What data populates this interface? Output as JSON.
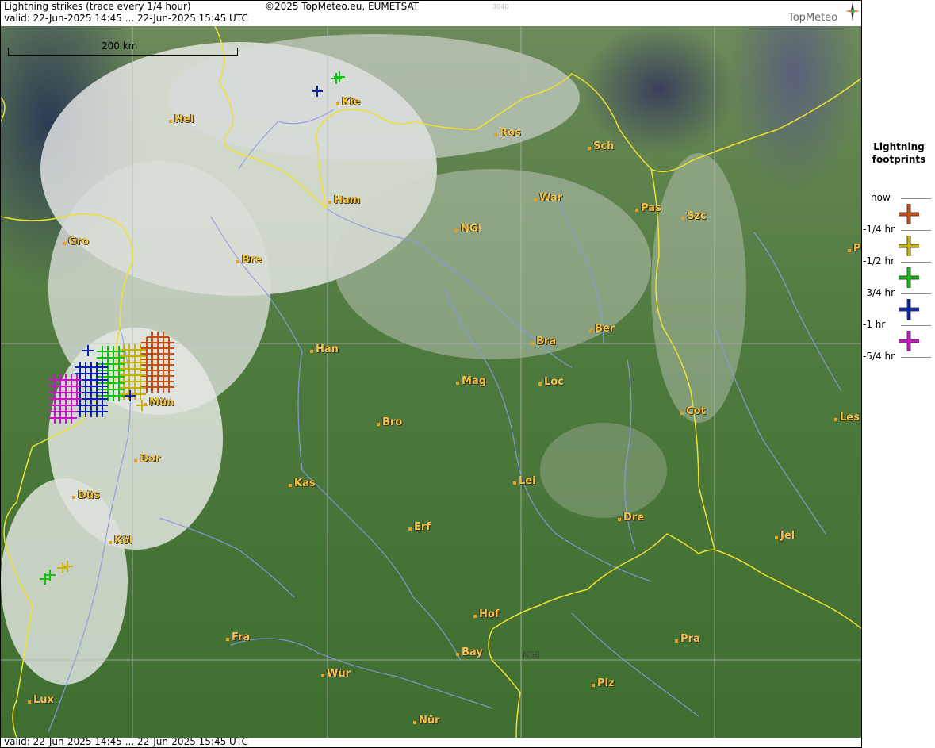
{
  "header": {
    "title": "Lightning strikes (trace every 1/4 hour)",
    "copyright": "©2025 TopMeteo.eu, EUMETSAT",
    "code": "3040",
    "valid": "valid:  22-Jun-2025 14:45 ... 22-Jun-2025 15:45 UTC",
    "logo": "TopMeteo"
  },
  "footer": {
    "valid": "valid:  22-Jun-2025 14:45 ... 22-Jun-2025 15:45 UTC"
  },
  "map": {
    "scale_label": "200 km",
    "gridline_label": "N50",
    "cities": [
      {
        "name": "Kie"
      },
      {
        "name": "Hel"
      },
      {
        "name": "Ros"
      },
      {
        "name": "Sch"
      },
      {
        "name": "Ham"
      },
      {
        "name": "War"
      },
      {
        "name": "NGl"
      },
      {
        "name": "Pas"
      },
      {
        "name": "Szc"
      },
      {
        "name": "Gro"
      },
      {
        "name": "Bre"
      },
      {
        "name": "Pi"
      },
      {
        "name": "Ber"
      },
      {
        "name": "Bra"
      },
      {
        "name": "Han"
      },
      {
        "name": "Mag"
      },
      {
        "name": "Loc"
      },
      {
        "name": "Mün"
      },
      {
        "name": "Cot"
      },
      {
        "name": "Les"
      },
      {
        "name": "Bro"
      },
      {
        "name": "Dor"
      },
      {
        "name": "Kas"
      },
      {
        "name": "Lei"
      },
      {
        "name": "Düs"
      },
      {
        "name": "Erf"
      },
      {
        "name": "Dre"
      },
      {
        "name": "Köl"
      },
      {
        "name": "Jel"
      },
      {
        "name": "Hof"
      },
      {
        "name": "Fra"
      },
      {
        "name": "Pra"
      },
      {
        "name": "Bay"
      },
      {
        "name": "Wür"
      },
      {
        "name": "Plz"
      },
      {
        "name": "Lux"
      },
      {
        "name": "Nür"
      }
    ]
  },
  "legend": {
    "title_line1": "Lightning",
    "title_line2": "footprints",
    "items": [
      {
        "label": "now",
        "color": "#c84b10"
      },
      {
        "label": "-1/4 hr",
        "color": "#c8b400"
      },
      {
        "label": "-1/2 hr",
        "color": "#10c010"
      },
      {
        "label": "-3/4 hr",
        "color": "#0a1eb4"
      },
      {
        "label": "-1 hr",
        "color": "#c814c8"
      },
      {
        "label": "-5/4 hr",
        "color": null
      }
    ]
  },
  "colors": {
    "border_line": "#f0e030",
    "river": "#8a9ae8",
    "grid": "#b8b8b8",
    "city_label": "#f5c542"
  }
}
